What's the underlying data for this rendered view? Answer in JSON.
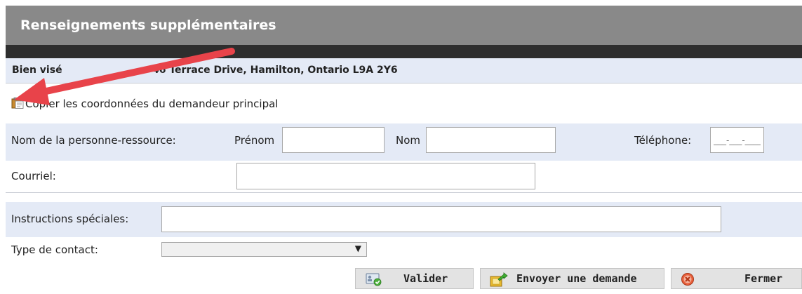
{
  "header": {
    "title": "Renseignements supplémentaires"
  },
  "property": {
    "label": "Bien visé",
    "value": "46 Terrace Drive, Hamilton, Ontario L9A 2Y6"
  },
  "copy_link": {
    "icon": "clipboard-icon",
    "label": "Copier les coordonnées du demandeur principal"
  },
  "contact": {
    "label": "Nom de la personne-ressource:",
    "first_name_label": "Prénom",
    "first_name_value": "",
    "last_name_label": "Nom",
    "last_name_value": "",
    "phone_label": "Téléphone:",
    "phone_placeholder": "___-___-____"
  },
  "email": {
    "label": "Courriel:",
    "value": ""
  },
  "instructions": {
    "label": "Instructions spéciales:",
    "value": ""
  },
  "contact_type": {
    "label": "Type de contact:",
    "selected": ""
  },
  "buttons": {
    "validate": {
      "label": "Valider",
      "icon": "validate-card-icon"
    },
    "send": {
      "label": "Envoyer une demande",
      "icon": "send-request-icon"
    },
    "close": {
      "label": "Fermer",
      "icon": "close-circle-icon"
    }
  },
  "colors": {
    "header_bg": "#898989",
    "row_bg": "#e4eaf6",
    "annotation_arrow": "#e8434a"
  }
}
